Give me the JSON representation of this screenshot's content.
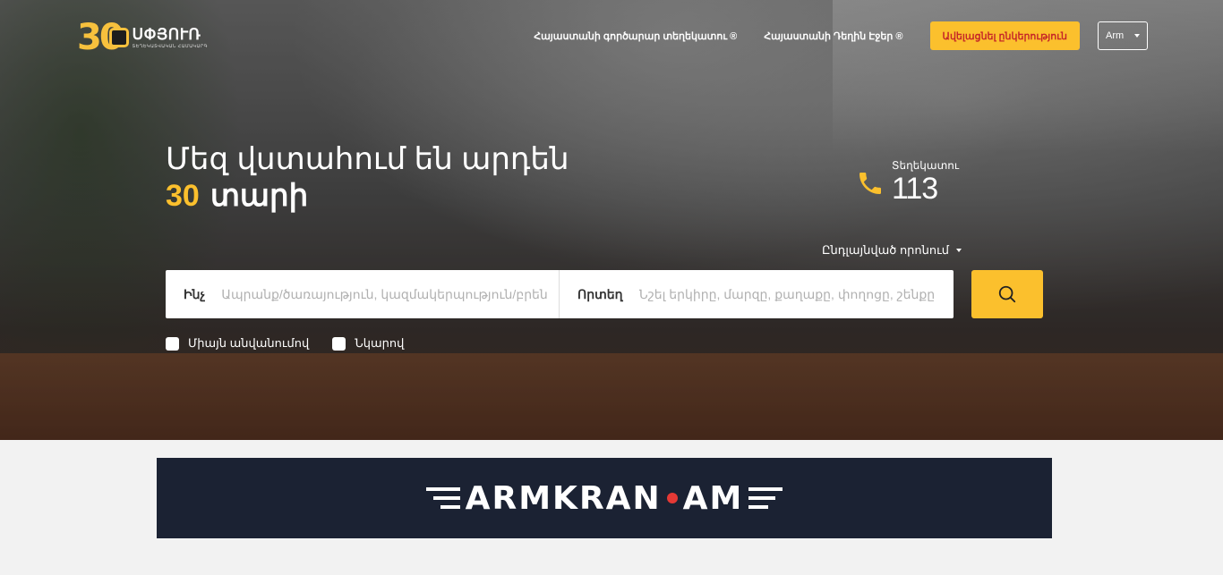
{
  "logo": {
    "number": "30",
    "name": "ՍՓՅՈՒՌ",
    "tagline": "ՏԵՂԵԿԱՏՎԱԿԱՆ ՀԱՄԱԿԱՐԳ"
  },
  "nav": {
    "links": [
      "Հայաստանի գործարար տեղեկատու ®",
      "Հայաստանի Դեղին Էջեր ®"
    ],
    "add_company": "Ավելացնել ընկերություն",
    "language": "Arm"
  },
  "hero": {
    "line1": "Մեզ վստահում են արդեն",
    "years": "30",
    "years_word": "տարի"
  },
  "hotline": {
    "label": "Տեղեկատու",
    "number": "113"
  },
  "search": {
    "advanced": "Ընդլայնված որոնում",
    "what_label": "Ինչ",
    "what_placeholder": "Ապրանք/ծառայություն, կազմակերպություն/բրեն",
    "where_label": "Որտեղ",
    "where_placeholder": "Նշել երկիրը, մարզը, քաղաքը, փողոցը, շենքը"
  },
  "filters": [
    "Միայն անվանումով",
    "Նկարով"
  ],
  "banner": {
    "part1": "ARMKRAN",
    "part2": "AM"
  },
  "colors": {
    "accent": "#fbc02d",
    "banner_bg": "#1b2233",
    "add_text": "#c62828"
  }
}
